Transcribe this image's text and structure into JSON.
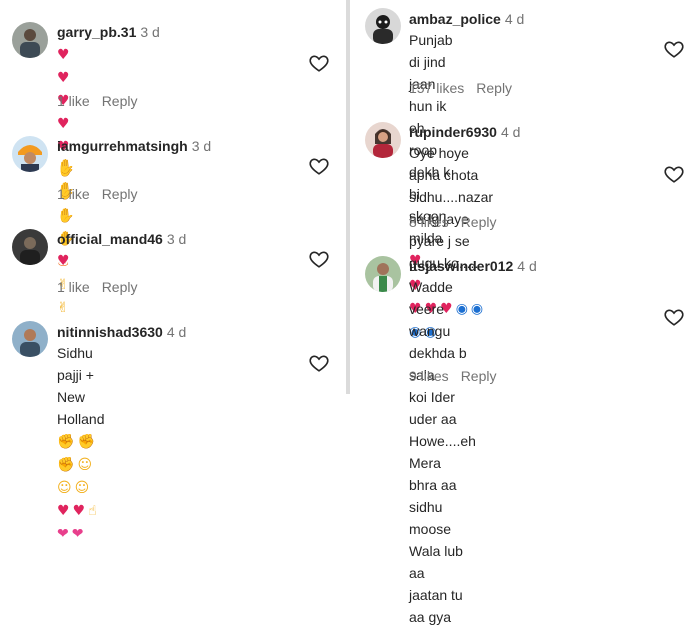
{
  "left": [
    {
      "username": "garry_pb.31",
      "time": "3 d",
      "emoji_line1": [
        "heart",
        "heart",
        "heart",
        "heart",
        "heart",
        "clap",
        "clap",
        "clap",
        "clap",
        "fire",
        "raise"
      ],
      "emoji_line2": [
        "raise"
      ],
      "likes": "1 like",
      "reply": "Reply"
    },
    {
      "username": "iamgurrehmatsingh",
      "time": "3 d",
      "emoji_line1": [
        "clap",
        "clap"
      ],
      "likes": "1 like",
      "reply": "Reply"
    },
    {
      "username": "official_mand46",
      "time": "3 d",
      "emoji_line1": [
        "heart"
      ],
      "likes": "1 like",
      "reply": "Reply"
    },
    {
      "username": "nitinnishad3630",
      "time": "4 d",
      "text": "Sidhu pajji + New Holland",
      "emoji_after_text": [
        "arm",
        "arm"
      ],
      "emoji_line2": [
        "arm",
        "cool",
        "cool",
        "cool",
        "heart",
        "heart",
        "thumb",
        "gift",
        "gift"
      ]
    }
  ],
  "right": [
    {
      "username": "ambaz_police",
      "time": "4 d",
      "text_line1": "Punjab di jind jaan hun ik eh roop",
      "text_line2": "dekh k hi skoon milda",
      "emoji_after_line2": [
        "heart"
      ],
      "likes": "157 likes",
      "reply": "Reply"
    },
    {
      "username": "rupinder6930",
      "time": "4 d",
      "text_line1": "Oye hoye apna chota sidhu....nazar",
      "text_line2": "na lg jaye pyare j se gugu ko.....",
      "emoji_after_line2": [
        "heart"
      ],
      "emoji_line3": [
        "heart",
        "heart",
        "heart",
        "eye",
        "eye",
        "eye",
        "eye"
      ],
      "likes": "8 likes",
      "reply": "Reply"
    },
    {
      "username": "itsjaswinder012",
      "time": "4 d",
      "text_line1": "Wadde veere wangu dekhda b sala",
      "text_line2": "koi Ider uder aa Howe....eh Mera",
      "text_line3": "bhra aa sidhu moose Wala lub aa",
      "text_line4": "jaatan tu aa gya",
      "likes": "9 likes",
      "reply": "Reply"
    }
  ],
  "emoji_glyphs": {
    "heart": "♥",
    "clap": "👏",
    "fire": "🔥",
    "raise": "🙌",
    "arm": "💪",
    "cool": "😎",
    "thumb": "👍",
    "gift": "💝",
    "eye": "🧿"
  },
  "icons": {
    "like": "heart-outline-icon"
  }
}
